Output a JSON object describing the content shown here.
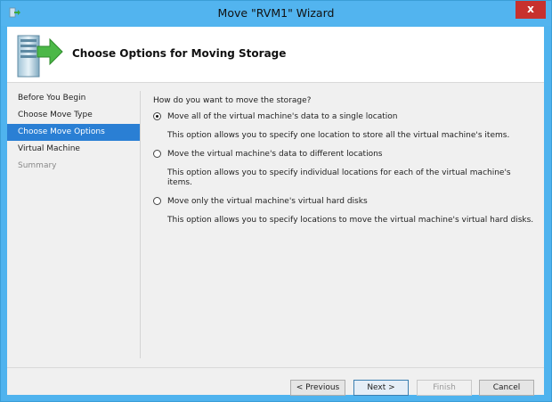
{
  "window": {
    "title": "Move \"RVM1\" Wizard",
    "close_glyph": "x"
  },
  "header": {
    "title": "Choose Options for Moving Storage",
    "icon": "server-move-icon"
  },
  "nav": {
    "items": [
      {
        "label": "Before You Begin",
        "state": "normal"
      },
      {
        "label": "Choose Move Type",
        "state": "normal"
      },
      {
        "label": "Choose Move Options",
        "state": "selected"
      },
      {
        "label": "Virtual Machine",
        "state": "normal"
      },
      {
        "label": "Summary",
        "state": "disabled"
      }
    ]
  },
  "main": {
    "question": "How do you want to move the storage?",
    "options": [
      {
        "label": "Move all of the virtual machine's data to a single location",
        "description": "This option allows you to specify one location to store all the virtual machine's items.",
        "checked": true
      },
      {
        "label": "Move the virtual machine's data to different locations",
        "description": "This option allows you to specify individual locations for each of the virtual machine's items.",
        "checked": false
      },
      {
        "label": "Move only the virtual machine's virtual hard disks",
        "description": "This option allows you to specify locations to move the virtual machine's virtual hard disks.",
        "checked": false
      }
    ]
  },
  "footer": {
    "previous_label": "< Previous",
    "next_label": "Next >",
    "finish_label": "Finish",
    "cancel_label": "Cancel"
  },
  "colors": {
    "titlebar": "#52b4ef",
    "selection": "#2a7fd4",
    "close": "#c7312e"
  }
}
